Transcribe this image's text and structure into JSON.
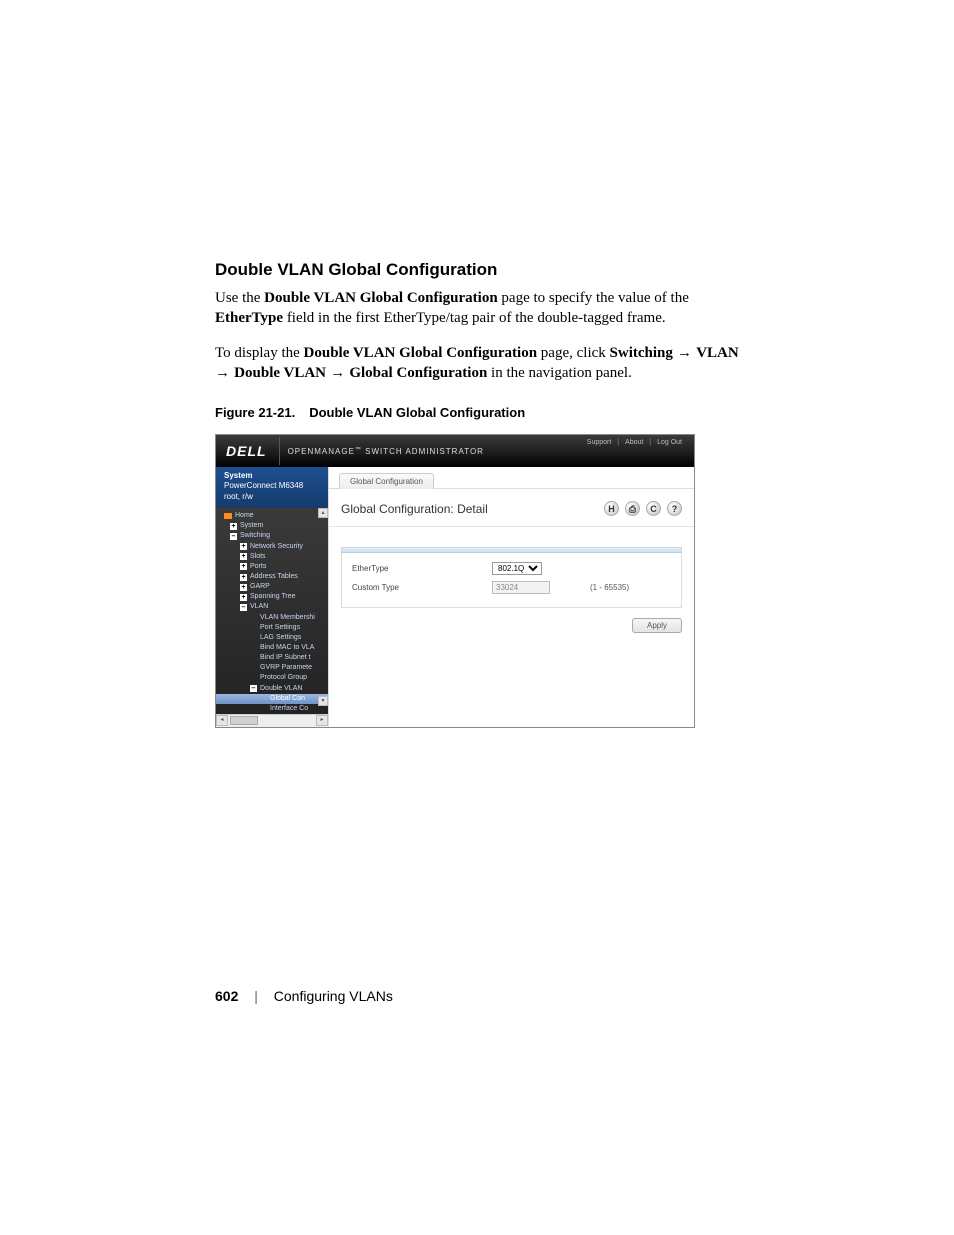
{
  "document": {
    "section_heading": "Double VLAN Global Configuration",
    "para1_a": "Use the ",
    "para1_b": "Double VLAN Global Configuration",
    "para1_c": " page to specify the value of the ",
    "para1_d": "EtherType",
    "para1_e": " field in the first EtherType/tag pair of the double-tagged frame.",
    "para2_a": "To display the ",
    "para2_b": "Double VLAN Global Configuration",
    "para2_c": " page, click ",
    "para2_d": "Switching",
    "arrow": " → ",
    "para2_e": "VLAN",
    "para2_f": "Double VLAN",
    "para2_g": "Global Configuration",
    "para2_h": " in the navigation panel.",
    "figure_num": "Figure 21-21.",
    "figure_title": "Double VLAN Global Configuration"
  },
  "ui": {
    "logo": "DELL",
    "app_title_a": "OPENMANAGE",
    "app_title_tm": "™",
    "app_title_b": " SWITCH ADMINISTRATOR",
    "top_links": {
      "support": "Support",
      "about": "About",
      "logout": "Log Out",
      "sep": "|"
    },
    "system_block": {
      "title": "System",
      "device": "PowerConnect M6348",
      "user": "root, r/w"
    },
    "tree": {
      "home": "Home",
      "system": "System",
      "switching": "Switching",
      "network_security": "Network Security",
      "slots": "Slots",
      "ports": "Ports",
      "address_tables": "Address Tables",
      "garp": "GARP",
      "spanning_tree": "Spanning Tree",
      "vlan": "VLAN",
      "vlan_membership": "VLAN Membershi",
      "port_settings": "Port Settings",
      "lag_settings": "LAG Settings",
      "bind_mac": "Bind MAC to VLA",
      "bind_ip": "Bind IP Subnet t",
      "gvrp": "GVRP Paramete",
      "protocol_group": "Protocol Group",
      "double_vlan": "Double VLAN",
      "global_conf": "Global Con",
      "interface_conf": "Interface Co"
    },
    "tab": "Global Configuration",
    "detail_title": "Global Configuration: Detail",
    "icons": {
      "save": "H",
      "print": "⎙",
      "refresh": "C",
      "help": "?"
    },
    "form": {
      "ethertype_label": "EtherType",
      "ethertype_value": "802.1Q",
      "custom_type_label": "Custom Type",
      "custom_type_value": "33024",
      "range": "(1 - 65535)"
    },
    "apply": "Apply"
  },
  "footer": {
    "page_number": "602",
    "section_name": "Configuring VLANs"
  }
}
